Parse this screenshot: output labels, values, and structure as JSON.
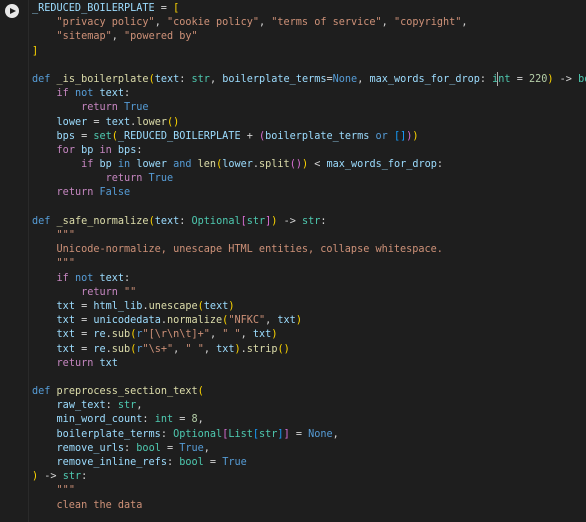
{
  "run_button": {
    "icon": "play-icon"
  },
  "code_lines": [
    [
      [
        "vr",
        "_REDUCED_BOILERPLATE"
      ],
      [
        "t",
        " = "
      ],
      [
        "pa",
        "["
      ]
    ],
    [
      [
        "t",
        "    "
      ],
      [
        "str",
        "\"privacy policy\""
      ],
      [
        "t",
        ", "
      ],
      [
        "str",
        "\"cookie policy\""
      ],
      [
        "t",
        ", "
      ],
      [
        "str",
        "\"terms of service\""
      ],
      [
        "t",
        ", "
      ],
      [
        "str",
        "\"copyright\""
      ],
      [
        "t",
        ","
      ]
    ],
    [
      [
        "t",
        "    "
      ],
      [
        "str",
        "\"sitemap\""
      ],
      [
        "t",
        ", "
      ],
      [
        "str",
        "\"powered by\""
      ]
    ],
    [
      [
        "pa",
        "]"
      ]
    ],
    [
      [
        "t",
        ""
      ]
    ],
    [
      [
        "kw",
        "def "
      ],
      [
        "fn",
        "_is_boilerplate"
      ],
      [
        "pa",
        "("
      ],
      [
        "vr",
        "text"
      ],
      [
        "t",
        ": "
      ],
      [
        "ty",
        "str"
      ],
      [
        "t",
        ", "
      ],
      [
        "vr",
        "boilerplate_terms"
      ],
      [
        "t",
        "="
      ],
      [
        "cst",
        "None"
      ],
      [
        "t",
        ", "
      ],
      [
        "vr",
        "max_words_for_drop"
      ],
      [
        "t",
        ": "
      ],
      [
        "ty",
        "int"
      ],
      [
        "t",
        " = "
      ],
      [
        "num",
        "220"
      ],
      [
        "pa",
        ")"
      ],
      [
        "t",
        " -> "
      ],
      [
        "ty",
        "bool"
      ],
      [
        "t",
        ":"
      ]
    ],
    [
      [
        "t",
        "    "
      ],
      [
        "ctl",
        "if "
      ],
      [
        "kw",
        "not "
      ],
      [
        "vr",
        "text"
      ],
      [
        "t",
        ":"
      ]
    ],
    [
      [
        "t",
        "        "
      ],
      [
        "ctl",
        "return "
      ],
      [
        "cst",
        "True"
      ]
    ],
    [
      [
        "t",
        "    "
      ],
      [
        "vr",
        "lower"
      ],
      [
        "t",
        " = "
      ],
      [
        "vr",
        "text"
      ],
      [
        "t",
        "."
      ],
      [
        "fn",
        "lower"
      ],
      [
        "pa",
        "()"
      ]
    ],
    [
      [
        "t",
        "    "
      ],
      [
        "vr",
        "bps"
      ],
      [
        "t",
        " = "
      ],
      [
        "ty",
        "set"
      ],
      [
        "pa",
        "("
      ],
      [
        "vr",
        "_REDUCED_BOILERPLATE"
      ],
      [
        "t",
        " + "
      ],
      [
        "pb",
        "("
      ],
      [
        "vr",
        "boilerplate_terms"
      ],
      [
        "t",
        " "
      ],
      [
        "kw",
        "or"
      ],
      [
        "t",
        " "
      ],
      [
        "pc",
        "[]"
      ],
      [
        "pb",
        ")"
      ],
      [
        "pa",
        ")"
      ]
    ],
    [
      [
        "t",
        "    "
      ],
      [
        "ctl",
        "for "
      ],
      [
        "vr",
        "bp"
      ],
      [
        "ctl",
        " in "
      ],
      [
        "vr",
        "bps"
      ],
      [
        "t",
        ":"
      ]
    ],
    [
      [
        "t",
        "        "
      ],
      [
        "ctl",
        "if "
      ],
      [
        "vr",
        "bp"
      ],
      [
        "kw",
        " in "
      ],
      [
        "vr",
        "lower"
      ],
      [
        "kw",
        " and "
      ],
      [
        "fn",
        "len"
      ],
      [
        "pa",
        "("
      ],
      [
        "vr",
        "lower"
      ],
      [
        "t",
        "."
      ],
      [
        "fn",
        "split"
      ],
      [
        "pb",
        "()"
      ],
      [
        "pa",
        ")"
      ],
      [
        "t",
        " < "
      ],
      [
        "vr",
        "max_words_for_drop"
      ],
      [
        "t",
        ":"
      ]
    ],
    [
      [
        "t",
        "            "
      ],
      [
        "ctl",
        "return "
      ],
      [
        "cst",
        "True"
      ]
    ],
    [
      [
        "t",
        "    "
      ],
      [
        "ctl",
        "return "
      ],
      [
        "cst",
        "False"
      ]
    ],
    [
      [
        "t",
        ""
      ]
    ],
    [
      [
        "kw",
        "def "
      ],
      [
        "fn",
        "_safe_normalize"
      ],
      [
        "pa",
        "("
      ],
      [
        "vr",
        "text"
      ],
      [
        "t",
        ": "
      ],
      [
        "ty",
        "Optional"
      ],
      [
        "pb",
        "["
      ],
      [
        "ty",
        "str"
      ],
      [
        "pb",
        "]"
      ],
      [
        "pa",
        ")"
      ],
      [
        "t",
        " -> "
      ],
      [
        "ty",
        "str"
      ],
      [
        "t",
        ":"
      ]
    ],
    [
      [
        "t",
        "    "
      ],
      [
        "str",
        "\"\"\""
      ]
    ],
    [
      [
        "str",
        "    Unicode-normalize, unescape HTML entities, collapse whitespace."
      ]
    ],
    [
      [
        "t",
        "    "
      ],
      [
        "str",
        "\"\"\""
      ]
    ],
    [
      [
        "t",
        "    "
      ],
      [
        "ctl",
        "if "
      ],
      [
        "kw",
        "not "
      ],
      [
        "vr",
        "text"
      ],
      [
        "t",
        ":"
      ]
    ],
    [
      [
        "t",
        "        "
      ],
      [
        "ctl",
        "return "
      ],
      [
        "str",
        "\"\""
      ]
    ],
    [
      [
        "t",
        "    "
      ],
      [
        "vr",
        "txt"
      ],
      [
        "t",
        " = "
      ],
      [
        "vr",
        "html_lib"
      ],
      [
        "t",
        "."
      ],
      [
        "fn",
        "unescape"
      ],
      [
        "pa",
        "("
      ],
      [
        "vr",
        "text"
      ],
      [
        "pa",
        ")"
      ]
    ],
    [
      [
        "t",
        "    "
      ],
      [
        "vr",
        "txt"
      ],
      [
        "t",
        " = "
      ],
      [
        "vr",
        "unicodedata"
      ],
      [
        "t",
        "."
      ],
      [
        "fn",
        "normalize"
      ],
      [
        "pa",
        "("
      ],
      [
        "str",
        "\"NFKC\""
      ],
      [
        "t",
        ", "
      ],
      [
        "vr",
        "txt"
      ],
      [
        "pa",
        ")"
      ]
    ],
    [
      [
        "t",
        "    "
      ],
      [
        "vr",
        "txt"
      ],
      [
        "t",
        " = "
      ],
      [
        "vr",
        "re"
      ],
      [
        "t",
        "."
      ],
      [
        "fn",
        "sub"
      ],
      [
        "pa",
        "("
      ],
      [
        "kw",
        "r"
      ],
      [
        "str",
        "\"[\\r\\n\\t]+\""
      ],
      [
        "t",
        ", "
      ],
      [
        "str",
        "\" \""
      ],
      [
        "t",
        ", "
      ],
      [
        "vr",
        "txt"
      ],
      [
        "pa",
        ")"
      ]
    ],
    [
      [
        "t",
        "    "
      ],
      [
        "vr",
        "txt"
      ],
      [
        "t",
        " = "
      ],
      [
        "vr",
        "re"
      ],
      [
        "t",
        "."
      ],
      [
        "fn",
        "sub"
      ],
      [
        "pa",
        "("
      ],
      [
        "kw",
        "r"
      ],
      [
        "str",
        "\"\\s+\""
      ],
      [
        "t",
        ", "
      ],
      [
        "str",
        "\" \""
      ],
      [
        "t",
        ", "
      ],
      [
        "vr",
        "txt"
      ],
      [
        "pa",
        ")"
      ],
      [
        "t",
        "."
      ],
      [
        "fn",
        "strip"
      ],
      [
        "pa",
        "()"
      ]
    ],
    [
      [
        "t",
        "    "
      ],
      [
        "ctl",
        "return "
      ],
      [
        "vr",
        "txt"
      ]
    ],
    [
      [
        "t",
        ""
      ]
    ],
    [
      [
        "kw",
        "def "
      ],
      [
        "fn",
        "preprocess_section_text"
      ],
      [
        "pa",
        "("
      ]
    ],
    [
      [
        "t",
        "    "
      ],
      [
        "vr",
        "raw_text"
      ],
      [
        "t",
        ": "
      ],
      [
        "ty",
        "str"
      ],
      [
        "t",
        ","
      ]
    ],
    [
      [
        "t",
        "    "
      ],
      [
        "vr",
        "min_word_count"
      ],
      [
        "t",
        ": "
      ],
      [
        "ty",
        "int"
      ],
      [
        "t",
        " = "
      ],
      [
        "num",
        "8"
      ],
      [
        "t",
        ","
      ]
    ],
    [
      [
        "t",
        "    "
      ],
      [
        "vr",
        "boilerplate_terms"
      ],
      [
        "t",
        ": "
      ],
      [
        "ty",
        "Optional"
      ],
      [
        "pb",
        "["
      ],
      [
        "ty",
        "List"
      ],
      [
        "pc",
        "["
      ],
      [
        "ty",
        "str"
      ],
      [
        "pc",
        "]"
      ],
      [
        "pb",
        "]"
      ],
      [
        "t",
        " = "
      ],
      [
        "cst",
        "None"
      ],
      [
        "t",
        ","
      ]
    ],
    [
      [
        "t",
        "    "
      ],
      [
        "vr",
        "remove_urls"
      ],
      [
        "t",
        ": "
      ],
      [
        "ty",
        "bool"
      ],
      [
        "t",
        " = "
      ],
      [
        "cst",
        "True"
      ],
      [
        "t",
        ","
      ]
    ],
    [
      [
        "t",
        "    "
      ],
      [
        "vr",
        "remove_inline_refs"
      ],
      [
        "t",
        ": "
      ],
      [
        "ty",
        "bool"
      ],
      [
        "t",
        " = "
      ],
      [
        "cst",
        "True"
      ]
    ],
    [
      [
        "pa",
        ")"
      ],
      [
        "t",
        " -> "
      ],
      [
        "ty",
        "str"
      ],
      [
        "t",
        ":"
      ]
    ],
    [
      [
        "t",
        "    "
      ],
      [
        "str",
        "\"\"\""
      ]
    ],
    [
      [
        "str",
        "    clean the data"
      ]
    ]
  ]
}
